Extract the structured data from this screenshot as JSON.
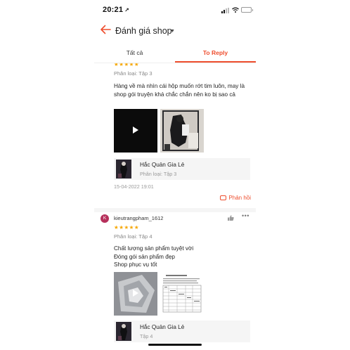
{
  "status_bar": {
    "time": "20:21",
    "location_glyph": "↗"
  },
  "header": {
    "title": "Đánh giá shop",
    "caret": "▼"
  },
  "tabs": [
    {
      "label": "Tất cả",
      "active": false
    },
    {
      "label": "To Reply",
      "active": true
    }
  ],
  "reviews": [
    {
      "stars": "★★★★★",
      "variant": "Phân loại: Tập 3",
      "text": "Hàng về mà nhìn cái hộp muốn rớt tim luôn, may là shop gói truyện khá chắc chắn nên ko bị sao cả",
      "product": {
        "name": "Hắc Quản Gia Lẻ",
        "variant": "Phân loại: Tập 3"
      },
      "date": "15-04-2022 19:01",
      "reply_label": "Phản hồi"
    },
    {
      "avatar_initial": "K",
      "username": "kieutrangpham_1612",
      "stars": "★★★★★",
      "variant": "Phân loại: Tập 4",
      "text": "Chất lượng sản phẩm tuyệt vời\nĐóng gói sản phẩm đẹp\nShop phục vụ tốt",
      "product": {
        "name": "Hắc Quản Gia Lẻ",
        "variant": "Tập 4"
      }
    }
  ],
  "colors": {
    "accent": "#ee4d2d",
    "star": "#f6a700",
    "avatar": "#b6305b"
  }
}
